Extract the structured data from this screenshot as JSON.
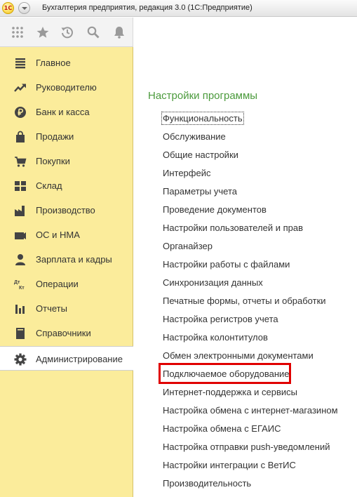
{
  "window": {
    "title": "Бухгалтерия предприятия, редакция 3.0  (1С:Предприятие)",
    "logo_text": "1С"
  },
  "toolbar": {
    "buttons": [
      {
        "icon": "apps-grid-icon"
      },
      {
        "icon": "star-icon"
      },
      {
        "icon": "history-icon"
      },
      {
        "icon": "search-icon"
      },
      {
        "icon": "bell-icon"
      }
    ]
  },
  "sidebar": {
    "items": [
      {
        "label": "Главное",
        "icon": "menu-lines-icon"
      },
      {
        "label": "Руководителю",
        "icon": "trend-up-icon"
      },
      {
        "label": "Банк и касса",
        "icon": "ruble-coin-icon"
      },
      {
        "label": "Продажи",
        "icon": "shopping-bag-icon"
      },
      {
        "label": "Покупки",
        "icon": "cart-icon"
      },
      {
        "label": "Склад",
        "icon": "warehouse-icon"
      },
      {
        "label": "Производство",
        "icon": "factory-icon"
      },
      {
        "label": "ОС и НМА",
        "icon": "fixed-assets-icon"
      },
      {
        "label": "Зарплата и кадры",
        "icon": "person-icon"
      },
      {
        "label": "Операции",
        "icon": "debit-credit-icon",
        "icon_text_top": "Дт",
        "icon_text_bottom": "Кт"
      },
      {
        "label": "Отчеты",
        "icon": "bar-chart-icon"
      },
      {
        "label": "Справочники",
        "icon": "book-icon"
      },
      {
        "label": "Администрирование",
        "icon": "gear-icon",
        "active": true
      }
    ]
  },
  "main": {
    "section_title": "Настройки программы",
    "links": [
      {
        "label": "Функциональность",
        "focused": true
      },
      {
        "label": "Обслуживание"
      },
      {
        "label": "Общие настройки"
      },
      {
        "label": "Интерфейс"
      },
      {
        "label": "Параметры учета"
      },
      {
        "label": "Проведение документов"
      },
      {
        "label": "Настройки пользователей и прав"
      },
      {
        "label": "Органайзер"
      },
      {
        "label": "Настройки работы с файлами"
      },
      {
        "label": "Синхронизация данных"
      },
      {
        "label": "Печатные формы, отчеты и обработки"
      },
      {
        "label": "Настройка регистров учета"
      },
      {
        "label": "Настройка колонтитулов"
      },
      {
        "label": "Обмен электронными документами"
      },
      {
        "label": "Подключаемое оборудование",
        "highlighted": true
      },
      {
        "label": "Интернет-поддержка и сервисы"
      },
      {
        "label": "Настройка обмена с интернет-магазином"
      },
      {
        "label": "Настройка обмена с ЕГАИС"
      },
      {
        "label": "Настройка отправки push-уведомлений"
      },
      {
        "label": "Настройки интеграции с ВетИС"
      },
      {
        "label": "Производительность"
      }
    ]
  },
  "colors": {
    "sidebar_bg": "#fbec9b",
    "section_title": "#4b9a3c",
    "highlight_border": "#e00000"
  }
}
